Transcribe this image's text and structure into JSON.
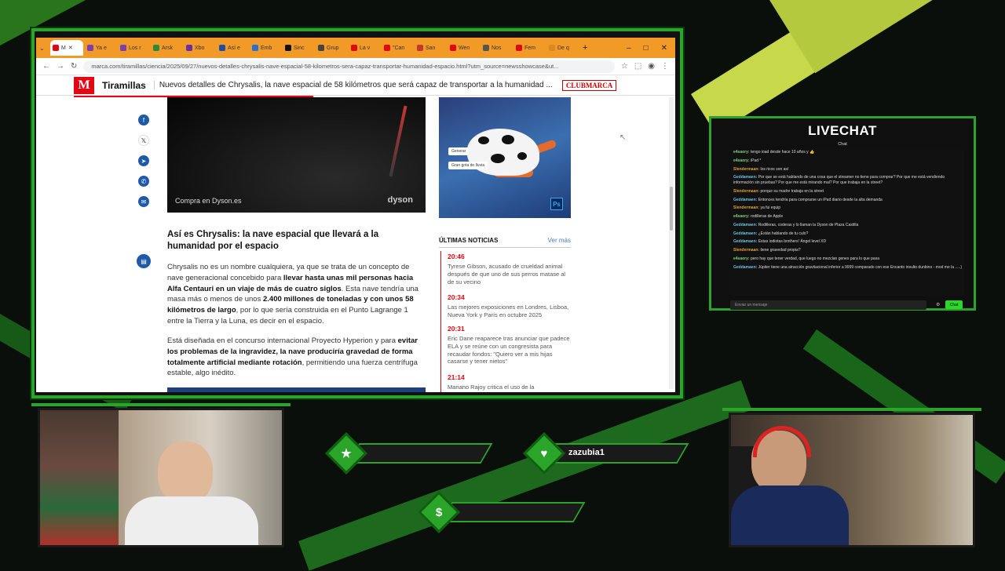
{
  "browser": {
    "tabs": [
      "M",
      "Ya e",
      "Los r",
      "Arsk",
      "Xbo",
      "Así e",
      "Emb",
      "Sinc",
      "Grup",
      "La v",
      "\"Can",
      "San",
      "Wen",
      "Nos",
      "Fem",
      "De q"
    ],
    "active_tab": "M",
    "url": "marca.com/tiramillas/ciencia/2025/09/27/nuevos-detalles-chrysalis-nave-espacial-58-kilometros-sera-capaz-transportar-humanidad-espacio.html?utm_source=newsshowcase&ut...",
    "controls": {
      "minimize": "–",
      "maximize": "□",
      "close": "✕"
    }
  },
  "site": {
    "logo": "M",
    "section": "Tiramillas",
    "headline": "Nuevos detalles de Chrysalis, la nave espacial de 58 kilómetros que será capaz de transportar a la humanidad ...",
    "club": "CLUBMARCA"
  },
  "ad": {
    "text": "Compra en Dyson.es",
    "brand": "dyson"
  },
  "article": {
    "heading": "Así es Chrysalis: la nave espacial que llevará a la humanidad por el espacio",
    "p1_a": "Chrysalis no es un nombre cualquiera, ya que se trata de un concepto de nave generacional concebido para ",
    "p1_b": "llevar hasta unas mil personas hacia Alfa Centauri en un viaje de más de cuatro siglos",
    "p1_c": ". Esta nave tendría una masa más o menos de unos ",
    "p1_d": "2.400 millones de toneladas y con unos 58 kilómetros de largo",
    "p1_e": ", por lo que sería construida en el Punto Lagrange 1 entre la Tierra y la Luna, es decir en el espacio.",
    "p2_a": "Está diseñada en el concurso internacional Proyecto Hyperion y para ",
    "p2_b": "evitar los problemas de la ingravidez, la nave produciría gravedad de forma totalmente artificial mediante rotación",
    "p2_c": ", permitiendo una fuerza centrífuga estable, algo inédito."
  },
  "promo": {
    "chip1": "Generar",
    "chip2": "Gran gota de lluvia",
    "ps": "Ps"
  },
  "latest": {
    "title": "ÚLTIMAS NOTICIAS",
    "more": "Ver más",
    "items": [
      {
        "time": "20:46",
        "text": "Tyrese Gibson, acusado de crueldad animal después de que uno de sus perros matase al de su vecino"
      },
      {
        "time": "20:34",
        "text": "Las mejores exposiciones en Londres, Lisboa, Nueva York y París en octubre 2025"
      },
      {
        "time": "20:31",
        "text": "Eric Dane reaparece tras anunciar que padece ELA y se reúne con un congresista para recaudar fondos: \"Quiero ver a mis hijas casarse y tener nietos\""
      },
      {
        "time": "21:14",
        "text": "Mariano Rajoy critica el uso de la"
      }
    ]
  },
  "chat": {
    "title": "LIVECHAT",
    "subtitle": "Chat",
    "messages": [
      {
        "user": "e4saory:",
        "text": "tengo ioad desde hace 10 años y 👍",
        "color": "#7cd67c"
      },
      {
        "user": "e4saory:",
        "text": "iPad *",
        "color": "#7cd67c"
      },
      {
        "user": "Slendermaan:",
        "text": "los ricos son así",
        "color": "#e0a030"
      },
      {
        "user": "Geddamaen:",
        "text": "Por que se está hablando de una cosa que el streamer no tiene para comprar? Por que me está vendiendo información sin pruebas? Por que me está mirando mal? Por que trabaja en la street?",
        "color": "#6cc0e0"
      },
      {
        "user": "Slendermaan:",
        "text": "porque su madre trabaja en la street",
        "color": "#e0a030"
      },
      {
        "user": "Geddamaen:",
        "text": "Entonces tendría para comprarse un iPad diario desde la alta demanda",
        "color": "#6cc0e0"
      },
      {
        "user": "Slendermaan:",
        "text": "ya fui equip",
        "color": "#e0a030"
      },
      {
        "user": "e4saory:",
        "text": "rodilleras de Apple",
        "color": "#7cd67c"
      },
      {
        "user": "Geddamaen:",
        "text": "Rodilleras, coderas y lo llaman la Dyson de Plaza Castilla",
        "color": "#6cc0e0"
      },
      {
        "user": "Geddamaen:",
        "text": "¿Están hablando de tu culo?",
        "color": "#6cc0e0"
      },
      {
        "user": "Geddamaen:",
        "text": "Estas iodiotas brothers! Ángel level XD",
        "color": "#6cc0e0"
      },
      {
        "user": "Slendermaan:",
        "text": "tiene gravedad propia?",
        "color": "#e0a030"
      },
      {
        "user": "e4saory:",
        "text": "pero hay que tener verdad, que luego no mezclan genes para lo que pasa",
        "color": "#7cd67c"
      },
      {
        "user": "Geddamaen:",
        "text": "Júpiter tiene una atracción gravitacional inferior a 9999 comparado con ese Encanto insulto dunbino - mod me la .....)",
        "color": "#6cc0e0"
      }
    ],
    "input_placeholder": "Enviar un mensaje",
    "send": "Chat"
  },
  "overlay": {
    "follower": "",
    "subscriber": "zazubia1",
    "donation": "",
    "icons": {
      "star": "★",
      "heart": "♥",
      "dollar": "$"
    }
  }
}
